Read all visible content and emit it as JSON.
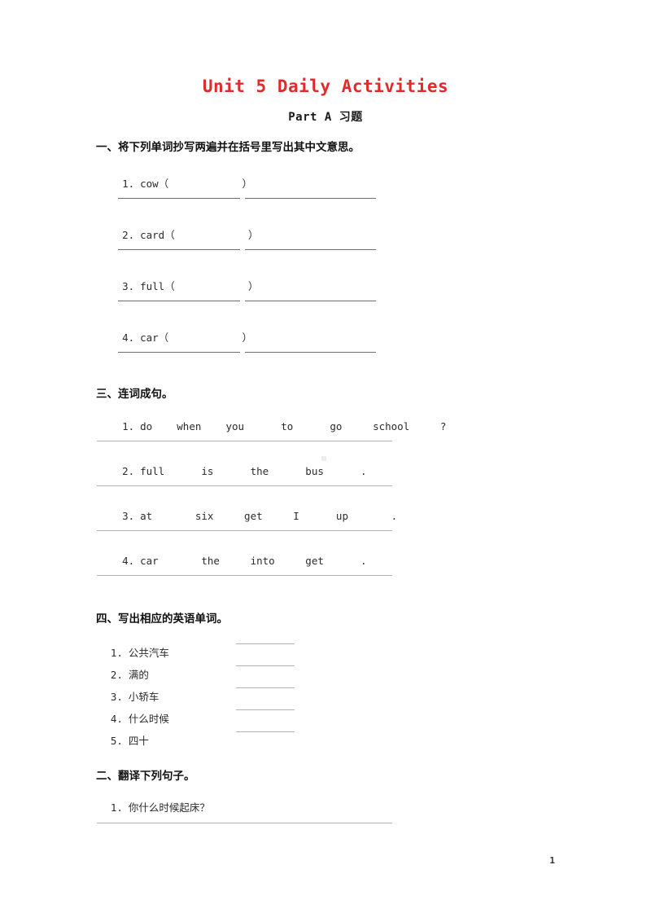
{
  "document": {
    "title": "Unit 5 Daily Activities",
    "subtitle": "Part A 习题",
    "title_color": "#e02b2b",
    "page_number": "1"
  },
  "sections": [
    {
      "id": "copy-words",
      "heading": "一、将下列单词抄写两遍并在括号里写出其中文意思。",
      "items": [
        {
          "index": "1.",
          "text": "cow（            ）"
        },
        {
          "index": "2.",
          "text": "card（            ）"
        },
        {
          "index": "3.",
          "text": "full（            ）"
        },
        {
          "index": "4.",
          "text": "car（            ）"
        }
      ]
    },
    {
      "id": "make-sentences",
      "heading": "三、连词成句。",
      "items": [
        {
          "index": "1.",
          "text": "do    when    you      to      go     school     ?"
        },
        {
          "index": "2.",
          "text": "full      is      the      bus      ."
        },
        {
          "index": "3.",
          "text": "at       six     get     I      up       ."
        },
        {
          "index": "4.",
          "text": "car       the     into     get      ."
        }
      ]
    },
    {
      "id": "write-english",
      "heading": "四、写出相应的英语单词。",
      "items": [
        {
          "index": "1.",
          "text": "公共汽车"
        },
        {
          "index": "2.",
          "text": "满的"
        },
        {
          "index": "3.",
          "text": "小轿车"
        },
        {
          "index": "4.",
          "text": "什么时候"
        },
        {
          "index": "5.",
          "text": "四十"
        }
      ]
    },
    {
      "id": "translate",
      "heading": "二、翻译下列句子。",
      "items": [
        {
          "index": "1.",
          "text": "你什么时候起床？"
        }
      ]
    }
  ]
}
